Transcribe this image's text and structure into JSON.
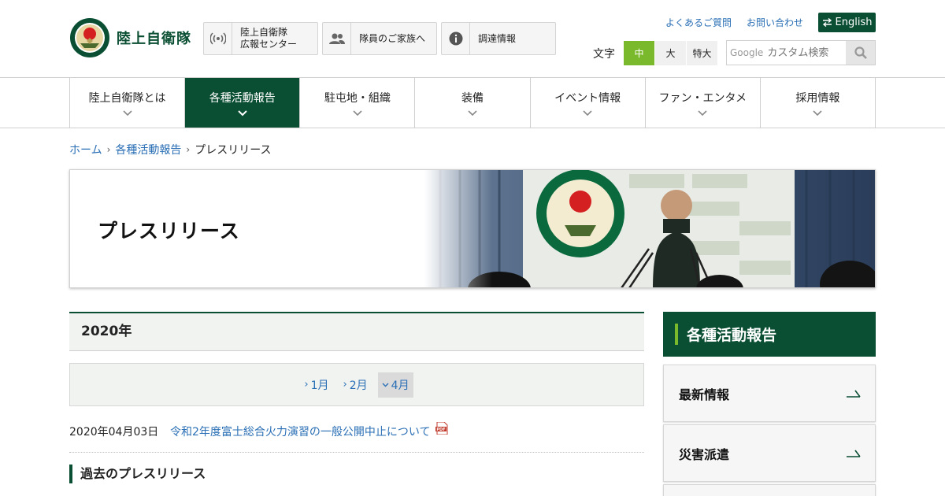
{
  "header": {
    "logo_text": "陸上自衛隊",
    "buttons": [
      {
        "label": "陸上自衛隊\n広報センター",
        "icon": "broadcast-icon"
      },
      {
        "label": "隊員のご家族へ",
        "icon": "people-icon"
      },
      {
        "label": "調達情報",
        "icon": "info-icon"
      }
    ],
    "links": [
      "よくあるご質問",
      "お問い合わせ"
    ],
    "english_label": "English",
    "font_size": {
      "label": "文字",
      "options": [
        "中",
        "大",
        "特大"
      ],
      "selected": "中"
    },
    "search": {
      "brand": "Google",
      "placeholder": "カスタム検索"
    }
  },
  "nav": {
    "items": [
      "陸上自衛隊とは",
      "各種活動報告",
      "駐屯地・組織",
      "装備",
      "イベント情報",
      "ファン・エンタメ",
      "採用情報"
    ],
    "active": "各種活動報告"
  },
  "breadcrumb": {
    "items": [
      "ホーム",
      "各種活動報告"
    ],
    "current": "プレスリリース"
  },
  "hero": {
    "title": "プレスリリース"
  },
  "main": {
    "year": "2020年",
    "months": [
      "1月",
      "2月",
      "4月"
    ],
    "active_month": "4月",
    "news": [
      {
        "date": "2020年04月03日",
        "title": "令和2年度富士総合火力演習の一般公開中止について",
        "type": "PDF"
      }
    ],
    "past_heading": "過去のプレスリリース"
  },
  "sidebar": {
    "heading": "各種活動報告",
    "items": [
      "最新情報",
      "災害派遣",
      ""
    ]
  },
  "colors": {
    "brand_green": "#0a4f33",
    "accent_green": "#7ab92c",
    "link_blue": "#2a6fb5"
  }
}
